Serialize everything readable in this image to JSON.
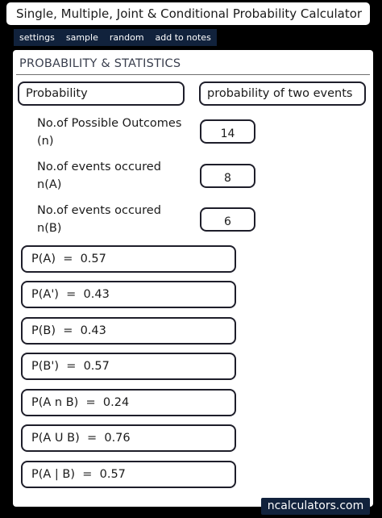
{
  "window": {
    "title": "Single, Multiple, Joint & Conditional Probability Calculator"
  },
  "toolbar": {
    "settings": "settings",
    "sample": "sample",
    "random": "random",
    "add_to_notes": "add to notes"
  },
  "panel": {
    "title": "PROBABILITY & STATISTICS"
  },
  "category": {
    "selected": "Probability"
  },
  "calculator": {
    "selected": "probability of two events"
  },
  "inputs": {
    "outcomes": {
      "label": "No.of Possible Outcomes (n)",
      "value": "14"
    },
    "events_a": {
      "label": "No.of events occured n(A)",
      "value": "8"
    },
    "events_b": {
      "label": "No.of events occured n(B)",
      "value": "6"
    }
  },
  "results": [
    "P(A)  =  0.57",
    "P(A')  =  0.43",
    "P(B)  =  0.43",
    "P(B')  =  0.57",
    "P(A n B)  =  0.24",
    "P(A U B)  =  0.76",
    "P(A | B)  =  0.57"
  ],
  "footer": {
    "brand": "ncalculators.com"
  },
  "colors": {
    "background": "#000000",
    "toolbar": "#11223c",
    "panel": "#ffffff",
    "border": "#1e1e2a"
  }
}
